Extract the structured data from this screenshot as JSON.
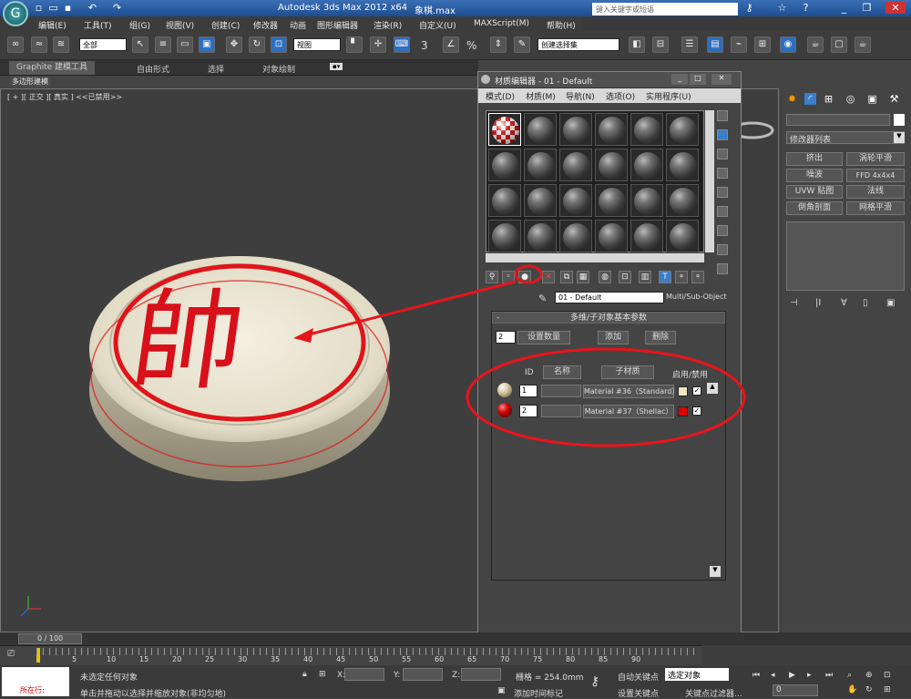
{
  "app": {
    "title": "Autodesk 3ds Max  2012 x64",
    "file": "象棋.max",
    "search_placeholder": "键入关键字或短语"
  },
  "menu": [
    "编辑(E)",
    "工具(T)",
    "组(G)",
    "视图(V)",
    "创建(C)",
    "修改器",
    "动画",
    "图形编辑器",
    "渲染(R)",
    "自定义(U)",
    "MAXScript(M)",
    "帮助(H)"
  ],
  "toolbar": {
    "filter_select": "全部",
    "view_select": "视图",
    "angle_snap_label": "3",
    "percent_label": "%",
    "named_selection": "创建选择集"
  },
  "ribbon": {
    "tabs": [
      "Graphite 建模工具",
      "自由形式",
      "选择",
      "对象绘制"
    ],
    "sub_tab": "多边形建模"
  },
  "viewport": {
    "label": "[ + ][ 正交 ][ 真实 ] <<已禁用>>",
    "piece_character": "帥",
    "piece_colors": {
      "body": "#e9e3cf",
      "ring": "#e0141a"
    }
  },
  "material_editor": {
    "title": "材质编辑器 - 01 - Default",
    "menu": [
      "模式(D)",
      "材质(M)",
      "导航(N)",
      "选项(O)",
      "实用程序(U)"
    ],
    "material_name": "01 - Default",
    "material_type": "Multi/Sub-Object",
    "rollout_title": "多维/子对象基本参数",
    "set_count_value": "2",
    "set_count_button": "设置数量",
    "add_button": "添加",
    "delete_button": "删除",
    "columns": {
      "id": "ID",
      "name": "名称",
      "submaterial": "子材质",
      "enable": "启用/禁用"
    },
    "rows": [
      {
        "id": "1",
        "material": "Material #36（Standard）",
        "color": "#f5e4c0",
        "enabled": "✓"
      },
      {
        "id": "2",
        "material": "Material #37（Shellac）",
        "color": "#e00000",
        "enabled": "✓"
      }
    ]
  },
  "command_panel": {
    "modifier_list": "修改器列表",
    "buttons": [
      "挤出",
      "涡轮平滑",
      "噪波",
      "FFD 4x4x4",
      "UVW 贴图",
      "法线",
      "倒角剖面",
      "网格平滑"
    ]
  },
  "timeline": {
    "frame": "0 / 100",
    "ticks": [
      "5",
      "10",
      "15",
      "20",
      "25",
      "30",
      "35",
      "40",
      "45",
      "50",
      "55",
      "60",
      "65",
      "70",
      "75",
      "80",
      "85",
      "90"
    ]
  },
  "status": {
    "location": "所在行:",
    "message1": "未选定任何对象",
    "message2": "单击并拖动以选择并缩放对象(非均匀地)",
    "x_label": "X:",
    "y_label": "Y:",
    "z_label": "Z:",
    "grid": "栅格 = 254.0mm",
    "add_time_tag": "添加时间标记",
    "auto_key": "自动关键点",
    "set_key": "设置关键点",
    "selected": "选定对象",
    "key_filter": "关键点过滤器...",
    "frame_value": "0"
  },
  "annotation_color": "#e8141a"
}
